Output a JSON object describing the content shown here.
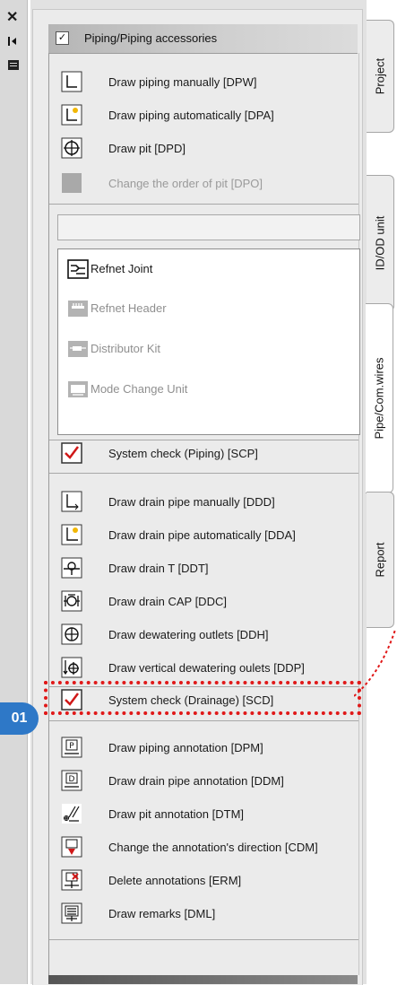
{
  "left_strip": {
    "icons": [
      "close-icon",
      "dock-icon",
      "panel-icon"
    ],
    "close_glyph": "✕"
  },
  "panel": {
    "header_title": "Piping/Piping accessories",
    "header_checked": true
  },
  "piping_tools": [
    {
      "label": "Draw piping manually [DPW]",
      "icon": "pipe-manual-icon",
      "enabled": true
    },
    {
      "label": "Draw piping automatically [DPA]",
      "icon": "pipe-auto-icon",
      "enabled": true
    },
    {
      "label": "Draw pit [DPD]",
      "icon": "pit-icon",
      "enabled": true
    },
    {
      "label": "Change the order of pit [DPO]",
      "icon": "pit-order-icon",
      "enabled": false
    }
  ],
  "search": {
    "value": ""
  },
  "refnet_list": [
    {
      "label": "Refnet Joint",
      "icon": "refnet-joint-icon",
      "enabled": true
    },
    {
      "label": "Refnet Header",
      "icon": "refnet-header-icon",
      "enabled": false
    },
    {
      "label": "Distributor Kit",
      "icon": "distributor-kit-icon",
      "enabled": false
    },
    {
      "label": "Mode Change Unit",
      "icon": "mode-change-unit-icon",
      "enabled": false
    }
  ],
  "system_check_piping": {
    "label": "System check (Piping) [SCP]",
    "icon": "system-check-icon"
  },
  "drain_tools": [
    {
      "label": "Draw drain pipe manually [DDD]",
      "icon": "drain-manual-icon"
    },
    {
      "label": "Draw drain pipe automatically [DDA]",
      "icon": "drain-auto-icon"
    },
    {
      "label": "Draw drain T [DDT]",
      "icon": "drain-t-icon"
    },
    {
      "label": "Draw drain CAP [DDC]",
      "icon": "drain-cap-icon"
    },
    {
      "label": "Draw dewatering outlets [DDH]",
      "icon": "dewatering-outlet-icon"
    },
    {
      "label": "Draw vertical dewatering oulets [DDP]",
      "icon": "vertical-dewatering-icon"
    }
  ],
  "system_check_drainage": {
    "label": "System check (Drainage) [SCD]",
    "icon": "system-check-icon"
  },
  "annotation_tools": [
    {
      "label": "Draw piping annotation [DPM]",
      "icon": "piping-annotation-icon"
    },
    {
      "label": "Draw drain pipe annotation [DDM]",
      "icon": "drain-annotation-icon"
    },
    {
      "label": "Draw pit annotation [DTM]",
      "icon": "pit-annotation-icon"
    },
    {
      "label": "Change the annotation's direction [CDM]",
      "icon": "annotation-direction-icon"
    },
    {
      "label": "Delete annotations [ERM]",
      "icon": "delete-annotation-icon"
    },
    {
      "label": "Draw remarks [DML]",
      "icon": "remarks-icon"
    }
  ],
  "tabs": [
    {
      "label": "Project",
      "active": false
    },
    {
      "label": "ID/OD unit",
      "active": false
    },
    {
      "label": "Pipe/Com.wires",
      "active": true
    },
    {
      "label": "Report",
      "active": false
    }
  ],
  "callout": {
    "badge": "01",
    "color": "#e01818",
    "badge_color": "#2e78c7"
  }
}
